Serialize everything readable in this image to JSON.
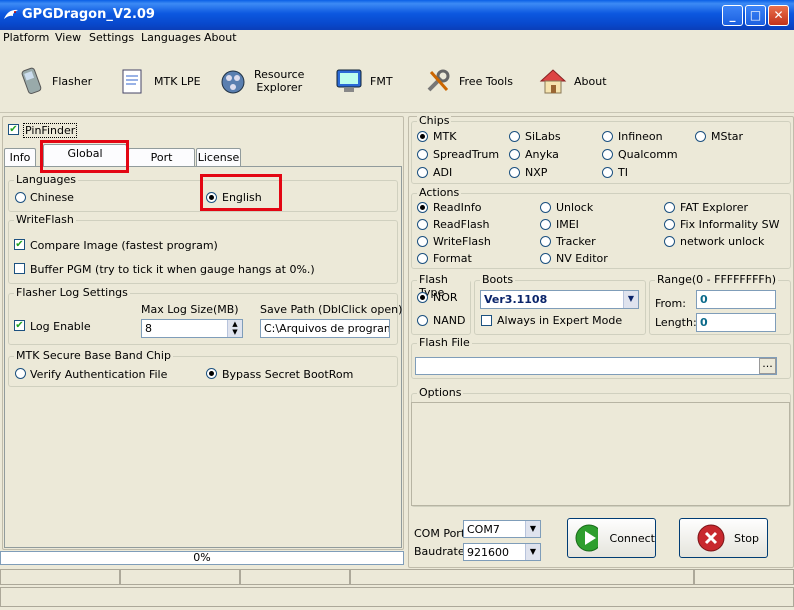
{
  "window": {
    "title": "GPGDragon_V2.09"
  },
  "menu": [
    "Platform",
    "View",
    "Settings",
    "Languages",
    "About"
  ],
  "toolbar": [
    {
      "label": "Flasher",
      "icon": "phone-icon"
    },
    {
      "label": "MTK LPE",
      "icon": "document-icon"
    },
    {
      "label": "Resource\nExplorer",
      "icon": "film-reel-icon"
    },
    {
      "label": "FMT",
      "icon": "computer-icon"
    },
    {
      "label": "Free Tools",
      "icon": "tools-icon"
    },
    {
      "label": "About",
      "icon": "house-icon"
    }
  ],
  "pinfinder": {
    "label": "PinFinder",
    "checked": true
  },
  "tabs": [
    "Info",
    "Global Settings",
    "Port Monitor",
    "License"
  ],
  "languages": {
    "title": "Languages",
    "options": [
      {
        "label": "Chinese",
        "selected": false
      },
      {
        "label": "English",
        "selected": true
      }
    ]
  },
  "writeflash": {
    "title": "WriteFlash",
    "compare": {
      "label": "Compare Image (fastest program)",
      "checked": true
    },
    "buffer": {
      "label": "Buffer PGM (try to tick it when gauge hangs at 0%.)",
      "checked": false
    }
  },
  "logsettings": {
    "title": "Flasher Log Settings",
    "log_enable": {
      "label": "Log Enable",
      "checked": true
    },
    "max_size_label": "Max Log Size(MB)",
    "max_size_value": "8",
    "save_path_label": "Save Path (DblClick open)",
    "save_path_value": "C:\\Arquivos de programas"
  },
  "secure": {
    "title": "MTK Secure Base Band Chip",
    "options": [
      {
        "label": "Verify Authentication File",
        "selected": false
      },
      {
        "label": "Bypass Secret BootRom",
        "selected": true
      }
    ]
  },
  "progress": {
    "text": "0%",
    "value": 0
  },
  "chips": {
    "title": "Chips",
    "options": [
      {
        "label": "MTK",
        "selected": true
      },
      {
        "label": "SiLabs",
        "selected": false
      },
      {
        "label": "Infineon",
        "selected": false
      },
      {
        "label": "MStar",
        "selected": false
      },
      {
        "label": "SpreadTrum",
        "selected": false
      },
      {
        "label": "Anyka",
        "selected": false
      },
      {
        "label": "Qualcomm",
        "selected": false
      },
      {
        "label": "ADI",
        "selected": false
      },
      {
        "label": "NXP",
        "selected": false
      },
      {
        "label": "TI",
        "selected": false
      }
    ]
  },
  "actions": {
    "title": "Actions",
    "options": [
      {
        "label": "ReadInfo",
        "selected": true
      },
      {
        "label": "Unlock",
        "selected": false
      },
      {
        "label": "FAT Explorer",
        "selected": false
      },
      {
        "label": "ReadFlash",
        "selected": false
      },
      {
        "label": "IMEI",
        "selected": false
      },
      {
        "label": "Fix Informality SW",
        "selected": false
      },
      {
        "label": "WriteFlash",
        "selected": false
      },
      {
        "label": "Tracker",
        "selected": false
      },
      {
        "label": "network unlock",
        "selected": false
      },
      {
        "label": "Format",
        "selected": false
      },
      {
        "label": "NV Editor",
        "selected": false
      }
    ]
  },
  "flashtype": {
    "title": "Flash Type",
    "options": [
      {
        "label": "NOR",
        "selected": true
      },
      {
        "label": "NAND",
        "selected": false
      }
    ]
  },
  "boots": {
    "title": "Boots",
    "value": "Ver3.1108",
    "expert": {
      "label": "Always in Expert Mode",
      "checked": false
    }
  },
  "range": {
    "title": "Range(0 - FFFFFFFFh)",
    "from_label": "From:",
    "from_value": "0",
    "length_label": "Length:",
    "length_value": "0"
  },
  "flashfile": {
    "title": "Flash File",
    "value": "",
    "browse": "..."
  },
  "options_box": {
    "title": "Options"
  },
  "com": {
    "port_label": "COM Port",
    "port_value": "COM7",
    "baud_label": "Baudrate",
    "baud_value": "921600"
  },
  "buttons": {
    "connect": "Connect",
    "stop": "Stop"
  },
  "colors": {
    "accent_red": "#e30613",
    "titlebar": "#0a5fe6",
    "connect_green": "#2e9e2e",
    "stop_red": "#c8282e"
  }
}
